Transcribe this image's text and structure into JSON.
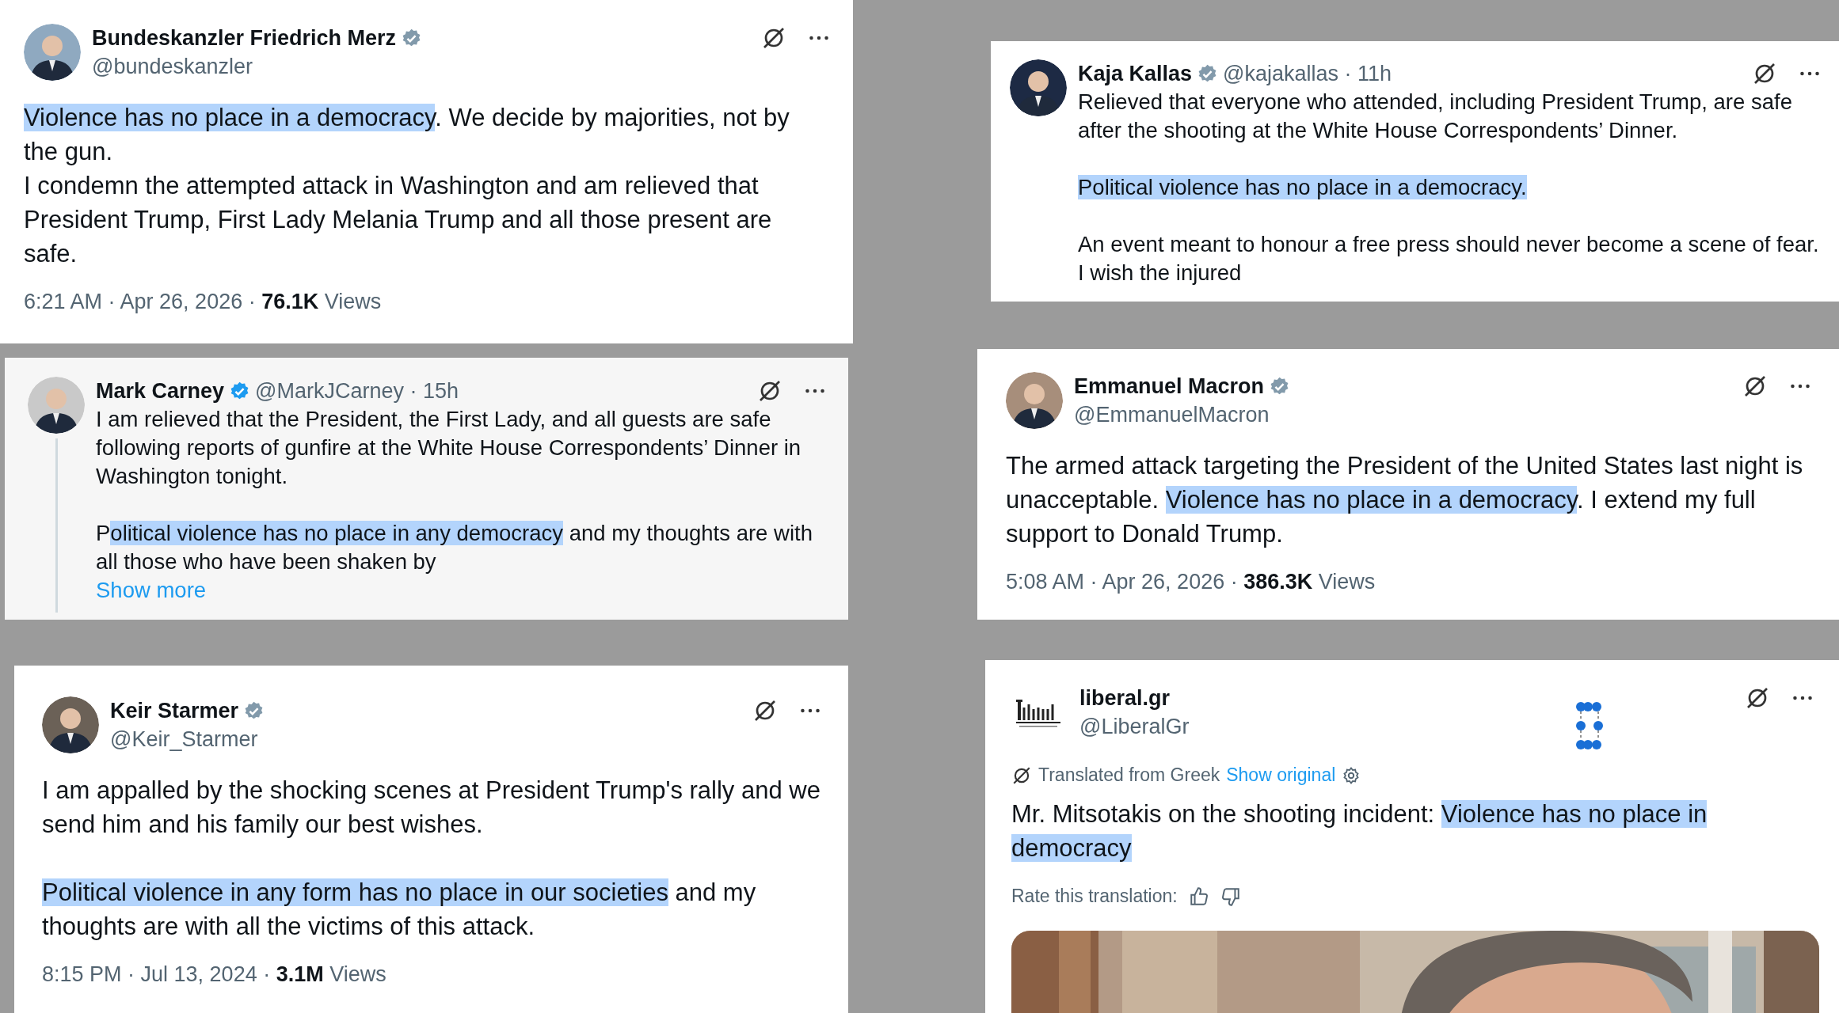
{
  "posts": [
    {
      "author": "Bundeskanzler Friedrich Merz",
      "badge": {
        "color": "#829aab"
      },
      "handle": "@bundeskanzler",
      "kind": "stacked",
      "thread_line": false,
      "blocks": [
        {
          "lines": [
            {
              "segments": [
                {
                  "text": "Violence has no place in a democracy",
                  "highlighted": true
                },
                {
                  "text": ". We decide by majorities, not by the gun.",
                  "highlighted": false
                }
              ]
            },
            {
              "segments": [
                {
                  "text": "I condemn the attempted attack in Washington and am relieved that President Trump, First Lady Melania Trump and all those present are safe.",
                  "highlighted": false
                }
              ]
            }
          ]
        }
      ],
      "meta": "6:21 AM · Apr 26, 2026 · **76.1K** Views"
    },
    {
      "author": "Kaja Kallas",
      "badge": {
        "color": "#829aab"
      },
      "handle": "@kajakallas · 11h",
      "kind": "inline",
      "thread_line": false,
      "blocks": [
        {
          "lines": [
            {
              "segments": [
                {
                  "text": "Relieved that everyone who attended, including President Trump, are safe after the shooting at the White House Correspondents’ Dinner.",
                  "highlighted": false
                }
              ]
            }
          ]
        },
        {
          "lines": [
            {
              "segments": [
                {
                  "text": "Political violence has no place in a democracy. ",
                  "highlighted": true
                }
              ]
            }
          ]
        },
        {
          "lines": [
            {
              "segments": [
                {
                  "text": "An event meant to honour a free press should never become a scene of fear. I wish the injured",
                  "highlighted": false
                }
              ]
            }
          ]
        }
      ]
    },
    {
      "author": "Mark Carney",
      "badge": {
        "color": "#1d9bf0"
      },
      "handle": "@MarkJCarney · 15h",
      "kind": "inline",
      "thread_line": true,
      "blocks": [
        {
          "lines": [
            {
              "segments": [
                {
                  "text": "I am relieved that the President, the First Lady, and all guests are safe following reports of gunfire at the White House Correspondents’ Dinner in Washington tonight.",
                  "highlighted": false
                }
              ]
            }
          ]
        },
        {
          "lines": [
            {
              "segments": [
                {
                  "text": "P",
                  "highlighted": false
                },
                {
                  "text": "olitical violence has no place in any democracy",
                  "highlighted": true
                },
                {
                  "text": " and my thoughts are with all those who have been shaken by",
                  "highlighted": false
                }
              ]
            }
          ]
        }
      ],
      "show_more": "Show more"
    },
    {
      "author": "Emmanuel Macron",
      "badge": {
        "color": "#829aab"
      },
      "handle": "@EmmanuelMacron",
      "kind": "stacked",
      "thread_line": false,
      "blocks": [
        {
          "lines": [
            {
              "segments": [
                {
                  "text": "The armed attack targeting the President of the United States last night is unacceptable. ",
                  "highlighted": false
                },
                {
                  "text": "Violence has no place in a democracy",
                  "highlighted": true
                },
                {
                  "text": ". I extend my full support to Donald Trump.",
                  "highlighted": false
                }
              ]
            }
          ]
        }
      ],
      "meta": "5:08 AM · Apr 26, 2026 · **386.3K** Views"
    },
    {
      "author": "Keir Starmer",
      "badge": {
        "color": "#829aab"
      },
      "handle": "@Keir_Starmer",
      "kind": "stacked",
      "thread_line": false,
      "blocks": [
        {
          "lines": [
            {
              "segments": [
                {
                  "text": "I am appalled by the shocking scenes at President Trump's rally and we send him and his family our best wishes.",
                  "highlighted": false
                }
              ]
            }
          ]
        },
        {
          "lines": [
            {
              "segments": [
                {
                  "text": "Political violence in any form has no place in our societies",
                  "highlighted": true
                },
                {
                  "text": " and my thoughts are with all the victims of this attack.",
                  "highlighted": false
                }
              ]
            }
          ]
        }
      ],
      "meta": "8:15 PM · Jul 13, 2024 · **3.1M** Views"
    },
    {
      "author": "liberal.gr",
      "handle": "@LiberalGr",
      "kind": "stacked",
      "thread_line": false,
      "translation": {
        "label": "Translated from Greek",
        "link": "Show original"
      },
      "blocks": [
        {
          "lines": [
            {
              "segments": [
                {
                  "text": "Mr. Mitsotakis on the shooting incident: ",
                  "highlighted": false
                },
                {
                  "text": "Violence has no place in democracy",
                  "highlighted": true
                }
              ]
            }
          ]
        }
      ],
      "rate_label": "Rate this translation:",
      "media": {
        "kind": "picture"
      }
    }
  ]
}
